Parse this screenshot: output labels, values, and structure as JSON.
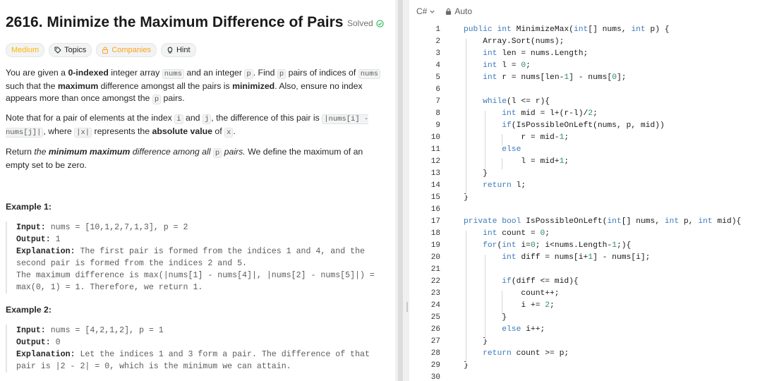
{
  "problem": {
    "title": "2616. Minimize the Maximum Difference of Pairs",
    "status": "Solved",
    "tags": [
      {
        "label": "Medium"
      },
      {
        "label": "Topics"
      },
      {
        "label": "Companies"
      },
      {
        "label": "Hint"
      }
    ],
    "p1": {
      "a": "You are given a ",
      "b": "0-indexed",
      "c": " integer array ",
      "d": "nums",
      "e": " and an integer ",
      "f": "p",
      "g": ". Find ",
      "h": "p",
      "i": " pairs of indices of ",
      "j": "nums",
      "k": " such that the ",
      "l": "maximum",
      "m": " difference amongst all the pairs is ",
      "n": "minimized",
      "o": ". Also, ensure no index appears more than once amongst the ",
      "p": "p",
      "q": " pairs."
    },
    "p2": {
      "a": "Note that for a pair of elements at the index ",
      "b": "i",
      "c": " and ",
      "d": "j",
      "e": ", the difference of this pair is ",
      "f": "|nums[i] - nums[j]|",
      "g": ", where ",
      "h": "|x|",
      "i": " represents the ",
      "j": "absolute value",
      "k": " of ",
      "l": "x",
      "m": "."
    },
    "p3": {
      "a": "Return ",
      "b": "the ",
      "c": "minimum maximum",
      "d": " difference among all ",
      "e": "p",
      "f": " pairs.",
      "g": " We define the maximum of an empty set to be zero."
    },
    "example1": {
      "heading": "Example 1:",
      "input_label": "Input:",
      "input": " nums = [10,1,2,7,1,3], p = 2",
      "output_label": "Output:",
      "output": " 1",
      "expl_label": "Explanation:",
      "expl": " The first pair is formed from the indices 1 and 4, and the second pair is formed from the indices 2 and 5.\nThe maximum difference is max(|nums[1] - nums[4]|, |nums[2] - nums[5]|) = max(0, 1) = 1. Therefore, we return 1."
    },
    "example2": {
      "heading": "Example 2:",
      "input_label": "Input:",
      "input": " nums = [4,2,1,2], p = 1",
      "output_label": "Output:",
      "output": " 0",
      "expl_label": "Explanation:",
      "expl": " Let the indices 1 and 3 form a pair. The difference of that pair is |2 - 2| = 0, which is the minimum we can attain."
    }
  },
  "editor": {
    "language": "C#",
    "mode": "Auto",
    "line_numbers": [
      "1",
      "2",
      "3",
      "4",
      "5",
      "6",
      "7",
      "8",
      "9",
      "10",
      "11",
      "12",
      "13",
      "14",
      "15",
      "16",
      "17",
      "18",
      "19",
      "20",
      "21",
      "22",
      "23",
      "24",
      "25",
      "26",
      "27",
      "28",
      "29",
      "30"
    ],
    "code_lines": [
      "public int MinimizeMax(int[] nums, int p) {",
      "    Array.Sort(nums);",
      "    int len = nums.Length;",
      "    int l = 0;",
      "    int r = nums[len-1] - nums[0];",
      "",
      "    while(l <= r){",
      "        int mid = l+(r-l)/2;",
      "        if(IsPossibleOnLeft(nums, p, mid))",
      "            r = mid-1;",
      "        else",
      "            l = mid+1;",
      "    }",
      "    return l;",
      "}",
      "",
      "private bool IsPossibleOnLeft(int[] nums, int p, int mid){",
      "    int count = 0;",
      "    for(int i=0; i<nums.Length-1;){",
      "        int diff = nums[i+1] - nums[i];",
      "",
      "        if(diff <= mid){",
      "            count++;",
      "            i += 2;",
      "        }",
      "        else i++;",
      "    }",
      "    return count >= p;",
      "}",
      ""
    ]
  },
  "colors": {
    "accent_green": "#2cbb5d",
    "medium": "#ffb800",
    "companies": "#ffa116",
    "keyword": "#3d7abb"
  }
}
